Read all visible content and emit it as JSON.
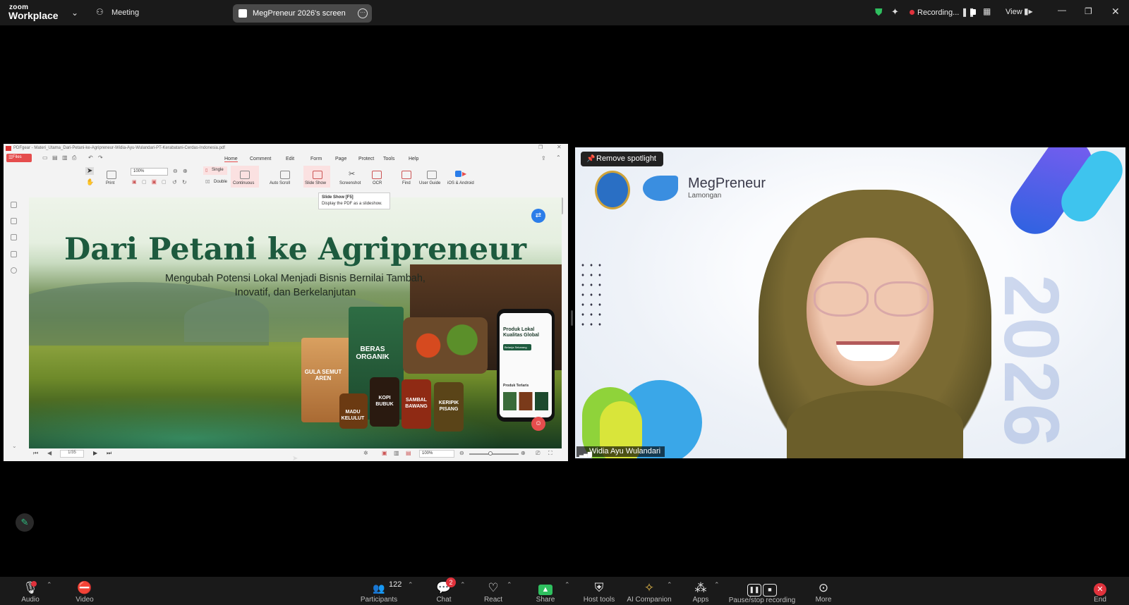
{
  "topbar": {
    "logo_small": "zoom",
    "logo_main": "Workplace",
    "meeting_label": "Meeting",
    "share_pill": "MegPreneur 2026's screen",
    "recording_label": "Recording...",
    "view_label": "View"
  },
  "pdf": {
    "window_title": "PDFgear - Materi_Utama_Dari-Petani-ke-Agripreneur-Widia-Ayu-Wulandari-PT-Kerabatani-Cerdas-Indonesia.pdf",
    "files_label": "Files",
    "menu": [
      "Home",
      "Comment",
      "Edit",
      "Form",
      "Page",
      "Protect",
      "Tools",
      "Help"
    ],
    "zoom_value": "100%",
    "tools": {
      "print": "Print",
      "single": "Single",
      "double": "Double",
      "continuous": "Continuous",
      "auto_scroll": "Auto Scroll",
      "slide_show": "Slide Show",
      "screenshot": "Screenshot",
      "ocr": "OCR",
      "find": "Find",
      "user_guide": "User Guide",
      "ios_android": "iOS & Android"
    },
    "tooltip_title": "Slide Show  [F5]",
    "tooltip_desc": "Display the PDF as a slideshow.",
    "page_indicator": "1/35",
    "status_zoom": "100%"
  },
  "slide": {
    "title": "Dari Petani ke Agripreneur",
    "subtitle_line1": "Mengubah Potensi Lokal Menjadi Bisnis Bernilai Tambah,",
    "subtitle_line2": "Inovatif, dan Berkelanjutan",
    "products": {
      "gula": "GULA SEMUT AREN",
      "beras": "BERAS ORGANIK",
      "madu": "MADU KELULUT",
      "kopi": "KOPI BUBUK",
      "sambal": "SAMBAL BAWANG",
      "keripik": "KERIPIK PISANG"
    },
    "phone_heading": "Produk Lokal Kualitas Global",
    "phone_button": "Belanja Sekarang",
    "phone_section": "Produk Terlaris"
  },
  "video": {
    "remove_spotlight": "Remove spotlight",
    "brand": "MegPreneur",
    "brand_sub": "Lamongan",
    "participant_name": "Widia Ayu Wulandari",
    "year_watermark": "2026"
  },
  "bottombar": {
    "audio": "Audio",
    "video": "Video",
    "participants": "Participants",
    "participants_count": "122",
    "chat": "Chat",
    "chat_badge": "2",
    "react": "React",
    "share": "Share",
    "host_tools": "Host tools",
    "ai_companion": "AI Companion",
    "apps": "Apps",
    "pause_stop": "Pause/stop recording",
    "more": "More",
    "end": "End"
  },
  "colors": {
    "share_green": "#2fbf5f",
    "end_red": "#e0323c",
    "slide_title_green": "#1d5a3e"
  }
}
